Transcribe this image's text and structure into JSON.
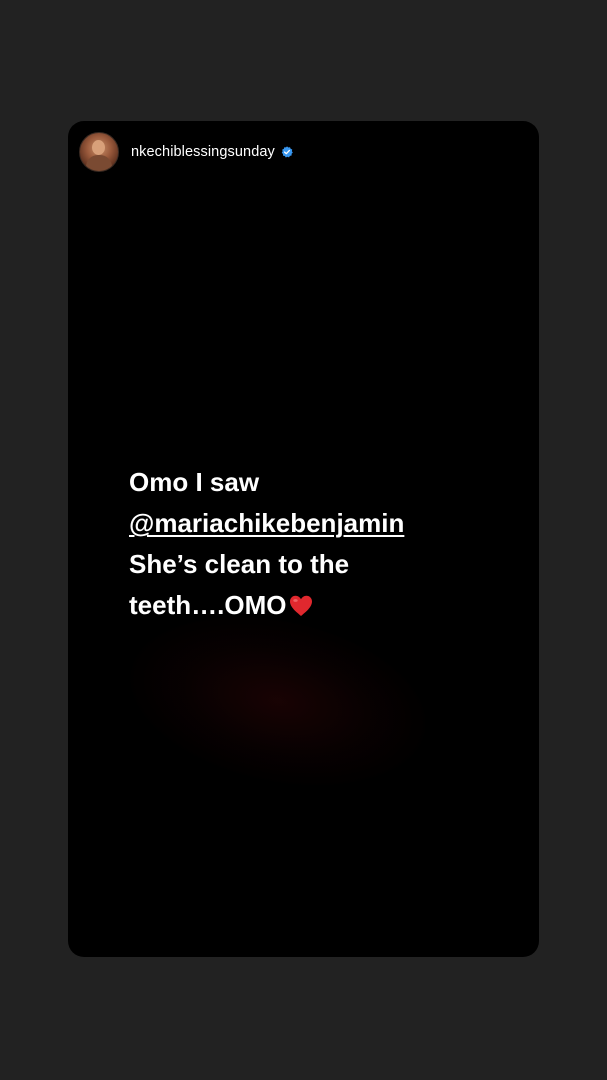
{
  "story": {
    "username": "nkechiblessingsunday",
    "verified": true,
    "text": {
      "line1": "Omo I saw",
      "mention": "@mariachikebenjamin",
      "line3": "She’s clean to the",
      "line4": "teeth….OMO"
    },
    "icons": {
      "verified": "verified-badge-icon",
      "heart": "red-heart-icon"
    },
    "colors": {
      "page_background": "#222222",
      "story_background": "#000000",
      "verified_blue": "#3897f0",
      "heart_red": "#e0282e"
    }
  }
}
